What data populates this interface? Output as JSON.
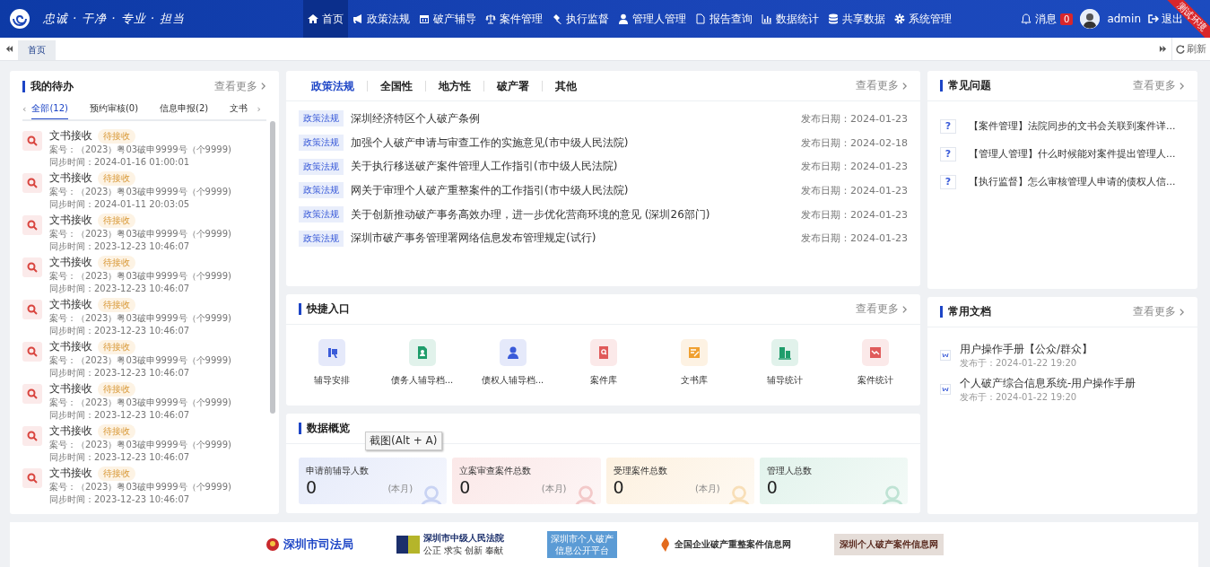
{
  "header": {
    "slogan": "忠诚 · 干净 · 专业 · 担当",
    "nav": [
      {
        "label": "首页",
        "selected": true
      },
      {
        "label": "政策法规",
        "selected": false
      },
      {
        "label": "破产辅导",
        "selected": false
      },
      {
        "label": "案件管理",
        "selected": false
      },
      {
        "label": "执行监督",
        "selected": false
      },
      {
        "label": "管理人管理",
        "selected": false
      },
      {
        "label": "报告查询",
        "selected": false
      },
      {
        "label": "数据统计",
        "selected": false
      },
      {
        "label": "共享数据",
        "selected": false
      },
      {
        "label": "系统管理",
        "selected": false
      }
    ],
    "messages": {
      "label": "消息",
      "count": "0"
    },
    "user": "admin",
    "logout": "退出",
    "ribbon": "测试环境"
  },
  "page_tabs": [
    {
      "label": "首页"
    }
  ],
  "refresh": "刷新",
  "todo": {
    "title": "我的待办",
    "more": "查看更多",
    "prev": "‹",
    "next": "›",
    "tabs": [
      {
        "label": "全部(12)",
        "selected": true
      },
      {
        "label": "预约审核(0)",
        "selected": false
      },
      {
        "label": "信息申报(2)",
        "selected": false
      },
      {
        "label": "文书",
        "selected": false
      }
    ],
    "items": [
      {
        "title": "文书接收",
        "status": "待接收",
        "case": "案号：（2023）粤03破申9999号（个9999)",
        "time": "同步时间：2024-01-16 01:00:01"
      },
      {
        "title": "文书接收",
        "status": "待接收",
        "case": "案号：（2023）粤03破申9999号（个9999)",
        "time": "同步时间：2024-01-11 20:03:05"
      },
      {
        "title": "文书接收",
        "status": "待接收",
        "case": "案号：（2023）粤03破申9999号（个9999)",
        "time": "同步时间：2023-12-23 10:46:07"
      },
      {
        "title": "文书接收",
        "status": "待接收",
        "case": "案号：（2023）粤03破申9999号（个9999)",
        "time": "同步时间：2023-12-23 10:46:07"
      },
      {
        "title": "文书接收",
        "status": "待接收",
        "case": "案号：（2023）粤03破申9999号（个9999)",
        "time": "同步时间：2023-12-23 10:46:07"
      },
      {
        "title": "文书接收",
        "status": "待接收",
        "case": "案号：（2023）粤03破申9999号（个9999)",
        "time": "同步时间：2023-12-23 10:46:07"
      },
      {
        "title": "文书接收",
        "status": "待接收",
        "case": "案号：（2023）粤03破申9999号（个9999)",
        "time": "同步时间：2023-12-23 10:46:07"
      },
      {
        "title": "文书接收",
        "status": "待接收",
        "case": "案号：（2023）粤03破申9999号（个9999)",
        "time": "同步时间：2023-12-23 10:46:07"
      },
      {
        "title": "文书接收",
        "status": "待接收",
        "case": "案号：（2023）粤03破申9999号（个9999)",
        "time": "同步时间：2023-12-23 10:46:07"
      }
    ]
  },
  "policy": {
    "tabs": [
      {
        "label": "政策法规",
        "selected": true
      },
      {
        "label": "全国性",
        "selected": false
      },
      {
        "label": "地方性",
        "selected": false
      },
      {
        "label": "破产署",
        "selected": false
      },
      {
        "label": "其他",
        "selected": false
      }
    ],
    "more": "查看更多",
    "items": [
      {
        "tag": "政策法规",
        "title": "深圳经济特区个人破产条例",
        "date": "发布日期：2024-01-23"
      },
      {
        "tag": "政策法规",
        "title": "加强个人破产申请与审查工作的实施意见(市中级人民法院)",
        "date": "发布日期：2024-02-18"
      },
      {
        "tag": "政策法规",
        "title": "关于执行移送破产案件管理人工作指引(市中级人民法院)",
        "date": "发布日期：2024-01-23"
      },
      {
        "tag": "政策法规",
        "title": "网关于审理个人破产重整案件的工作指引(市中级人民法院)",
        "date": "发布日期：2024-01-23"
      },
      {
        "tag": "政策法规",
        "title": "关于创新推动破产事务高效办理，进一步优化营商环境的意见 (深圳26部门)",
        "date": "发布日期：2024-01-23"
      },
      {
        "tag": "政策法规",
        "title": "深圳市破产事务管理署网络信息发布管理规定(试行)",
        "date": "发布日期：2024-01-23"
      }
    ]
  },
  "quick": {
    "title": "快捷入口",
    "more": "查看更多",
    "items": [
      {
        "label": "辅导安排",
        "color": "#3a5bd9"
      },
      {
        "label": "债务人辅导档...",
        "color": "#1f9d6b"
      },
      {
        "label": "债权人辅导档...",
        "color": "#3a5bd9"
      },
      {
        "label": "案件库",
        "color": "#e05a5a"
      },
      {
        "label": "文书库",
        "color": "#f0a030"
      },
      {
        "label": "辅导统计",
        "color": "#1f9d6b"
      },
      {
        "label": "案件统计",
        "color": "#e05a5a"
      }
    ]
  },
  "overview": {
    "title": "数据概览",
    "tooltip": "截图(Alt + A)",
    "cards": [
      {
        "label": "申请前辅导人数",
        "value": "0",
        "period": "(本月)"
      },
      {
        "label": "立案审查案件总数",
        "value": "0",
        "period": "(本月)"
      },
      {
        "label": "受理案件总数",
        "value": "0",
        "period": "(本月)"
      },
      {
        "label": "管理人总数",
        "value": "0"
      }
    ]
  },
  "faq": {
    "title": "常见问题",
    "more": "查看更多",
    "items": [
      {
        "mark": "?",
        "text": "【案件管理】法院同步的文书会关联到案件详..."
      },
      {
        "mark": "?",
        "text": "【管理人管理】什么时候能对案件提出管理人..."
      },
      {
        "mark": "?",
        "text": "【执行监督】怎么审核管理人申请的债权人信..."
      }
    ]
  },
  "docs": {
    "title": "常用文档",
    "more": "查看更多",
    "items": [
      {
        "title": "用户操作手册【公众/群众】",
        "date": "发布于：2024-01-22 19:20"
      },
      {
        "title": "个人破产综合信息系统-用户操作手册",
        "date": "发布于：2024-01-22 19:20"
      }
    ]
  },
  "footer": [
    {
      "kind": "emblem",
      "text": "深圳市司法局"
    },
    {
      "kind": "court",
      "text": "深圳市中级人民法院",
      "sub": "公正 求实 创新 奉献"
    },
    {
      "kind": "box",
      "text": "深圳市个人破产信息公开平台"
    },
    {
      "kind": "flame",
      "text": "全国企业破产重整案件信息网"
    },
    {
      "kind": "plain",
      "text": "深圳个人破产案件信息网"
    }
  ]
}
